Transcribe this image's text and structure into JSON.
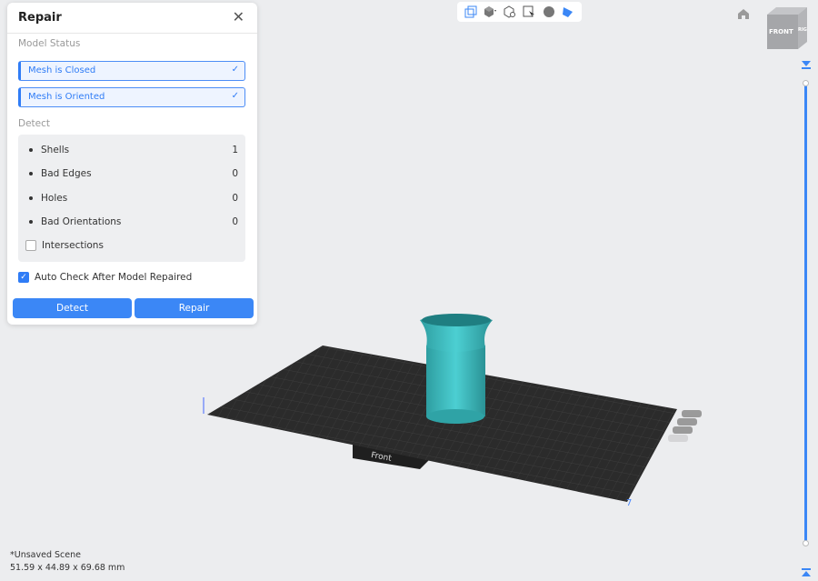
{
  "panel": {
    "title": "Repair",
    "model_status_label": "Model Status",
    "status": [
      "Mesh is Closed",
      "Mesh is Oriented"
    ],
    "detect_label": "Detect",
    "items": [
      {
        "label": "Shells",
        "value": "1"
      },
      {
        "label": "Bad Edges",
        "value": "0"
      },
      {
        "label": "Holes",
        "value": "0"
      },
      {
        "label": "Bad Orientations",
        "value": "0"
      }
    ],
    "intersections_label": "Intersections",
    "auto_check_label": "Auto Check After Model Repaired",
    "detect_button": "Detect",
    "repair_button": "Repair"
  },
  "viewcube": {
    "front": "FRONT",
    "right": "RIGHT"
  },
  "plate_label": "Front",
  "footer": {
    "scene": "*Unsaved Scene",
    "dimensions": "51.59 x 44.89 x 69.68 mm"
  },
  "colors": {
    "accent": "#3b87f6",
    "model": "#3bb5b8",
    "plate": "#2b2b2b"
  }
}
